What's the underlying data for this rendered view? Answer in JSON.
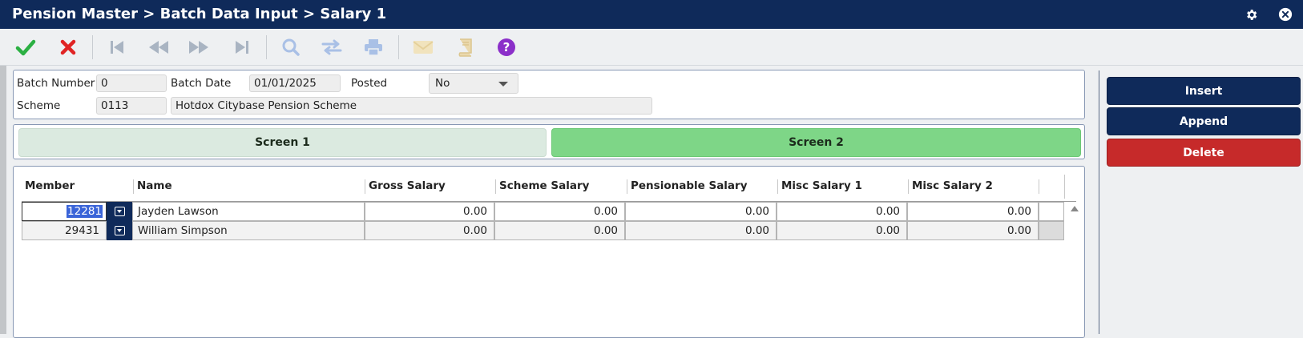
{
  "window": {
    "title": "Pension Master > Batch Data Input > Salary 1"
  },
  "icons": {
    "settings": "gear-icon",
    "close": "close-icon",
    "confirm": "checkmark-icon",
    "cancel": "cross-icon",
    "first": "first-record-icon",
    "previous": "rewind-icon",
    "next": "fast-forward-icon",
    "last": "last-record-icon",
    "search": "search-icon",
    "swap": "swap-icon",
    "print": "printer-icon",
    "email": "envelope-icon",
    "notes": "notebook-icon",
    "help": "help-icon"
  },
  "colors": {
    "titlebar": "#0f2a5a",
    "confirm": "#2bb043",
    "cancel": "#e02424",
    "help": "#8b2fc9",
    "tab_active": "#7ed687",
    "tab_inactive": "#dbeae0",
    "button_primary": "#0f2a5a",
    "button_danger": "#c62a2a"
  },
  "header": {
    "batch_number_label": "Batch Number",
    "batch_number_value": "0",
    "batch_date_label": "Batch Date",
    "batch_date_value": "01/01/2025",
    "posted_label": "Posted",
    "posted_value": "No",
    "scheme_label": "Scheme",
    "scheme_code": "0113",
    "scheme_name": "Hotdox Citybase Pension Scheme"
  },
  "tabs": [
    {
      "label": "Screen 1",
      "active": false
    },
    {
      "label": "Screen 2",
      "active": true
    }
  ],
  "grid": {
    "columns": [
      "Member",
      "Name",
      "Gross Salary",
      "Scheme Salary",
      "Pensionable Salary",
      "Misc Salary 1",
      "Misc Salary 2"
    ],
    "rows": [
      {
        "member": "12281",
        "name": "Jayden Lawson",
        "gross": "0.00",
        "scheme": "0.00",
        "pensionable": "0.00",
        "misc1": "0.00",
        "misc2": "0.00"
      },
      {
        "member": "29431",
        "name": "William Simpson",
        "gross": "0.00",
        "scheme": "0.00",
        "pensionable": "0.00",
        "misc1": "0.00",
        "misc2": "0.00"
      }
    ]
  },
  "actions": {
    "insert": "Insert",
    "append": "Append",
    "delete": "Delete"
  }
}
